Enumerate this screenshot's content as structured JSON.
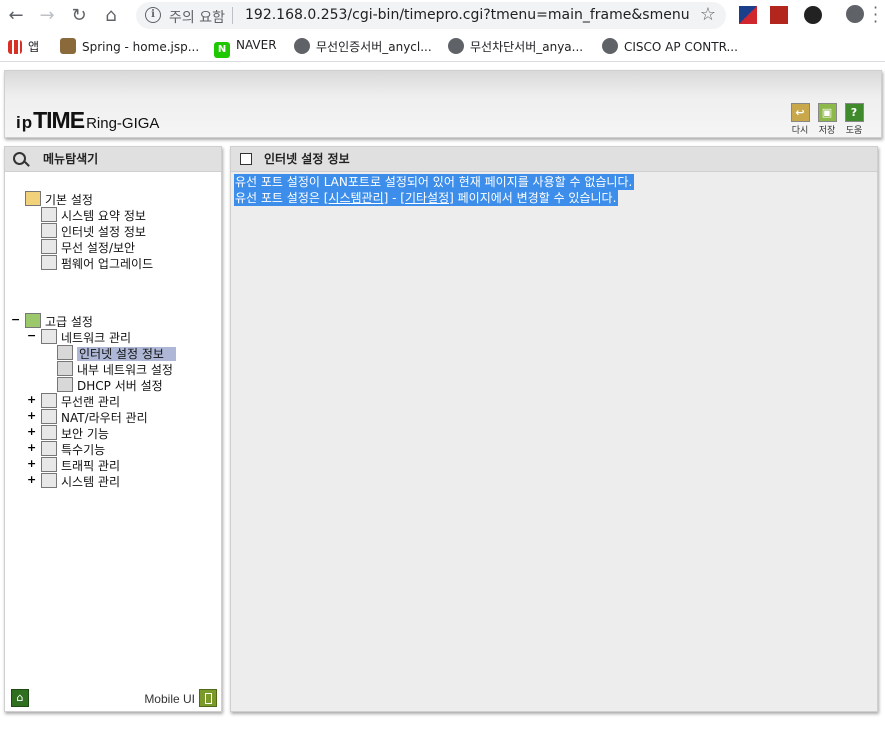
{
  "browser": {
    "security_label": "주의 요함",
    "url": "192.168.0.253/cgi-bin/timepro.cgi?tmenu=main_frame&smenu=ma...",
    "bookmarks": [
      {
        "label": "앱"
      },
      {
        "label": "Spring - home.jsp..."
      },
      {
        "label": "NAVER"
      },
      {
        "label": "무선인증서버_anycl..."
      },
      {
        "label": "무선차단서버_anya..."
      },
      {
        "label": "CISCO AP CONTR..."
      }
    ]
  },
  "header": {
    "logo_ip": "ip",
    "logo_time": "TIME",
    "logo_model": "Ring-GIGA",
    "buttons": [
      {
        "label": "다시",
        "icon": "refresh-icon",
        "color": "#c8a84a"
      },
      {
        "label": "저장",
        "icon": "save-icon",
        "color": "#8db84a"
      },
      {
        "label": "도움",
        "icon": "help-icon",
        "color": "#3f8a2a"
      }
    ]
  },
  "left_panel": {
    "title": "메뉴탐색기",
    "basic": {
      "label": "기본 설정",
      "items": [
        "시스템 요약 정보",
        "인터넷 설정 정보",
        "무선 설정/보안",
        "펌웨어 업그레이드"
      ]
    },
    "advanced": {
      "label": "고급 설정",
      "network": {
        "label": "네트워크 관리",
        "items": [
          "인터넷 설정 정보",
          "내부 네트워크 설정",
          "DHCP 서버 설정"
        ]
      },
      "groups": [
        "무선랜 관리",
        "NAT/라우터 관리",
        "보안 기능",
        "특수기능",
        "트래픽 관리",
        "시스템 관리"
      ]
    },
    "mobile_label": "Mobile UI"
  },
  "right_panel": {
    "title": "인터넷 설정 정보",
    "line1": "유선 포트 설정이 LAN포트로 설정되어 있어 현재 페이지를 사용할 수 없습니다.",
    "line2_prefix": "유선 포트 설정은 ",
    "link_system": "[시스템관리]",
    "line2_dash": " - ",
    "link_other": "[기타설정]",
    "line2_suffix": " 페이지에서 변경할 수 있습니다."
  },
  "colors": {
    "selection": "#3d8eea",
    "tree_selected": "#aeb8d6",
    "content_bg": "#ededed"
  }
}
